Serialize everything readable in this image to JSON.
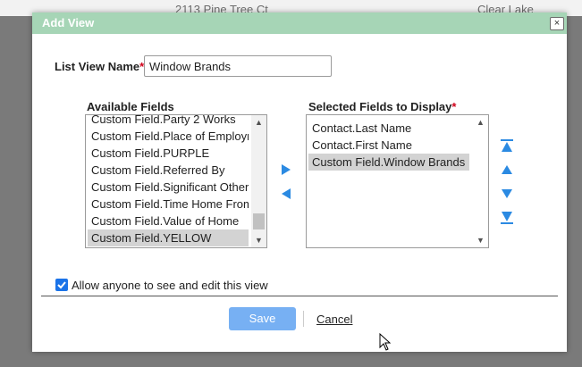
{
  "background": {
    "address": "2113 Pine Tree Ct",
    "city": "Clear Lake"
  },
  "dialog": {
    "title": "Add View",
    "close_label": "×"
  },
  "form": {
    "list_view_name_label": "List View Name",
    "required_marker": "*",
    "list_view_name_value": "Window Brands"
  },
  "available_fields": {
    "label": "Available Fields",
    "items": [
      "Custom Field.Party 2 Works",
      "Custom Field.Place of Employment",
      "Custom Field.PURPLE",
      "Custom Field.Referred By",
      "Custom Field.Significant Other",
      "Custom Field.Time Home From",
      "Custom Field.Value of Home",
      "Custom Field.YELLOW"
    ],
    "selected_item": "Custom Field.YELLOW"
  },
  "selected_fields": {
    "label": "Selected Fields to Display",
    "items": [
      "Contact.Last Name",
      "Contact.First Name",
      "Custom Field.Window Brands"
    ],
    "selected_item": "Custom Field.Window Brands"
  },
  "permissions": {
    "allow_label": "Allow anyone to see and edit this view",
    "allow_checked": true
  },
  "actions": {
    "save_label": "Save",
    "cancel_label": "Cancel"
  },
  "icons": {
    "move_right": "triangle-right-icon",
    "move_left": "triangle-left-icon",
    "move_top": "move-to-top-icon",
    "move_up": "move-up-icon",
    "move_down": "move-down-icon",
    "move_bottom": "move-to-bottom-icon",
    "check": "checkmark-icon",
    "cursor": "mouse-pointer-icon"
  },
  "colors": {
    "title_bar": "#a6d5b6",
    "accent_blue": "#2b8ae2",
    "save_button": "#77b0f3",
    "selected_row": "#d3d3d3",
    "required": "#d0021b",
    "checkbox": "#1a73e8"
  }
}
